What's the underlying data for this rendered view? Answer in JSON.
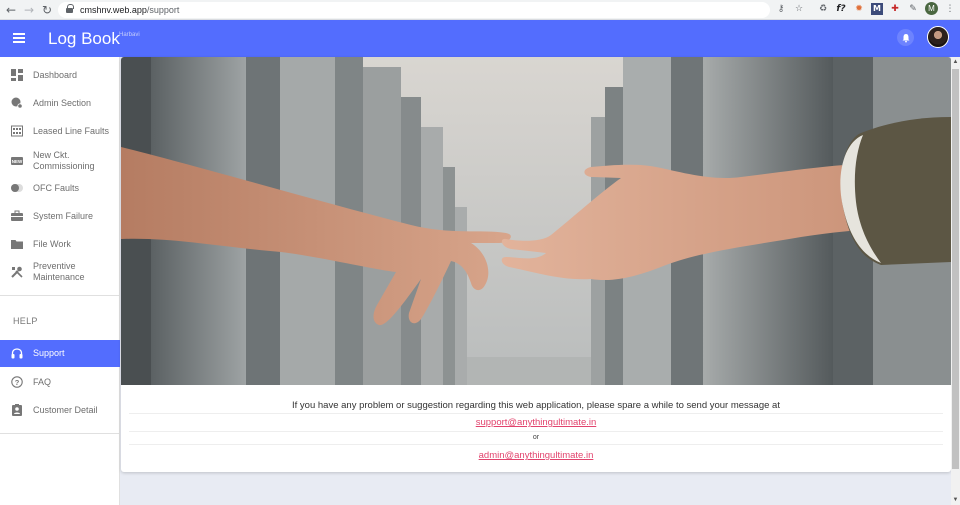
{
  "browser": {
    "url_host": "cmshnv.web.app",
    "url_path": "/support",
    "profile_initial": "M",
    "icons": [
      "back-icon",
      "forward-icon",
      "reload-icon",
      "key-icon",
      "star-icon",
      "recycle-icon",
      "formula-icon",
      "extension-icon",
      "m-icon",
      "extension-red-icon",
      "puzzle-icon",
      "profile-avatar",
      "more-vert-icon"
    ]
  },
  "appbar": {
    "title": "Log Book",
    "subtitle": "Harbavi",
    "color": "#536dfe"
  },
  "sidebar": {
    "items": [
      {
        "label": "Dashboard",
        "icon": "dashboard-icon"
      },
      {
        "label": "Admin Section",
        "icon": "admin-icon"
      },
      {
        "label": "Leased Line Faults",
        "icon": "building-icon"
      },
      {
        "label": "New Ckt. Commissioning",
        "icon": "new-icon"
      },
      {
        "label": "OFC Faults",
        "icon": "toggle-icon"
      },
      {
        "label": "System Failure",
        "icon": "briefcase-icon"
      },
      {
        "label": "File Work",
        "icon": "folder-icon"
      },
      {
        "label": "Preventive Maintenance",
        "icon": "tools-icon"
      }
    ],
    "help_section": "HELP",
    "help_items": [
      {
        "label": "Support",
        "icon": "headset-icon",
        "active": true
      },
      {
        "label": "FAQ",
        "icon": "help-circle-icon"
      },
      {
        "label": "Customer Detail",
        "icon": "contact-icon"
      }
    ]
  },
  "support": {
    "message": "If you have any problem or suggestion regarding this web application, please spare a while to send your message at",
    "email_primary": "support@anythingultimate.in",
    "or_text": "or",
    "email_secondary": "admin@anythingultimate.in",
    "link_color": "#e2436d"
  }
}
